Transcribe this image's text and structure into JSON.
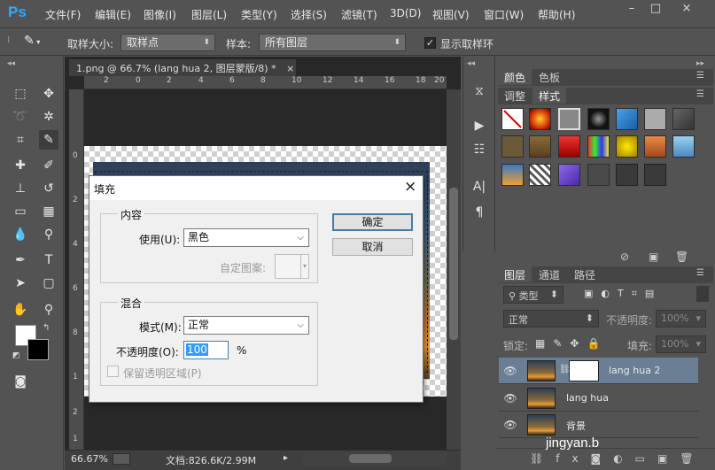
{
  "app": {
    "logo": "Ps"
  },
  "menu": [
    "文件(F)",
    "编辑(E)",
    "图像(I)",
    "图层(L)",
    "类型(Y)",
    "选择(S)",
    "滤镜(T)",
    "3D(D)",
    "视图(V)",
    "窗口(W)",
    "帮助(H)"
  ],
  "window_controls": [
    "–",
    "□",
    "×"
  ],
  "options": {
    "sample_size_label": "取样大小:",
    "sample_size_value": "取样点",
    "sample_label": "样本:",
    "sample_value": "所有图层",
    "show_ring_label": "显示取样环",
    "show_ring_checked": true
  },
  "document": {
    "tab_title": "1.png @ 66.7% (lang hua 2, 图层蒙版/8) *",
    "tab_close": "×",
    "ruler_ticks": [
      "2",
      "0",
      "2",
      "4",
      "6",
      "8",
      "10",
      "12",
      "14",
      "16",
      "18",
      "20"
    ],
    "ruler_v_ticks": [
      "0",
      "2",
      "4",
      "6",
      "8",
      "1",
      "2",
      "1"
    ]
  },
  "status": {
    "zoom": "66.67%",
    "doc_size": "文档:826.6K/2.99M"
  },
  "dialog": {
    "title": "填充",
    "close": "×",
    "content_group": "内容",
    "use_label": "使用(U):",
    "use_value": "黑色",
    "custom_pattern_label": "自定图案:",
    "blend_group": "混合",
    "mode_label": "模式(M):",
    "mode_value": "正常",
    "opacity_label": "不透明度(O):",
    "opacity_value": "100",
    "opacity_unit": "%",
    "preserve_label": "保留透明区域(P)",
    "preserve_checked": false,
    "ok_button": "确定",
    "cancel_button": "取消"
  },
  "panels": {
    "top_tabs": [
      "颜色",
      "色板"
    ],
    "second_tabs": [
      "调整",
      "样式"
    ],
    "layers_tabs": [
      "图层",
      "通道",
      "路径"
    ],
    "filter_kind": "类型",
    "blend_mode": "正常",
    "opacity_label": "不透明度:",
    "opacity_value": "100%",
    "lock_label": "锁定:",
    "fill_label": "填充:",
    "fill_value": "100%",
    "layers": [
      {
        "name": "lang hua 2",
        "selected": true,
        "has_mask": true
      },
      {
        "name": "lang hua",
        "selected": false,
        "has_mask": false
      },
      {
        "name": "背景",
        "selected": false,
        "has_mask": false
      }
    ]
  },
  "watermark": "jingyan.b",
  "colors": {
    "accent_blue": "#31a8ff",
    "selected_layer": "#6b7f94",
    "dialog_bg": "#f0f0f0"
  }
}
